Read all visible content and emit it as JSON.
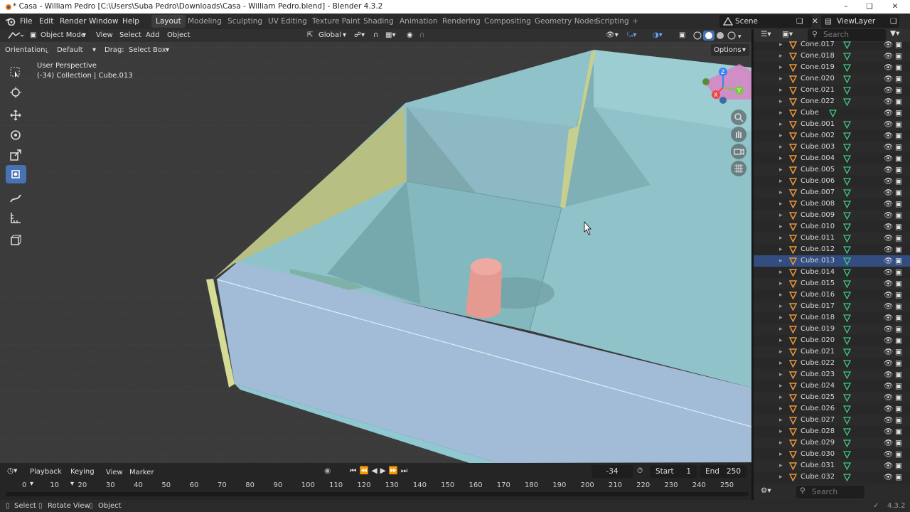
{
  "window": {
    "title": "* Casa - William Pedro [C:\\Users\\Suba Pedro\\Downloads\\Casa - William Pedro.blend] - Blender 4.3.2"
  },
  "menu": {
    "items": [
      "File",
      "Edit",
      "Render",
      "Window",
      "Help"
    ]
  },
  "workspaces": [
    {
      "label": "Layout",
      "active": true
    },
    {
      "label": "Modeling",
      "active": false
    },
    {
      "label": "Sculpting",
      "active": false
    },
    {
      "label": "UV Editing",
      "active": false
    },
    {
      "label": "Texture Paint",
      "active": false
    },
    {
      "label": "Shading",
      "active": false
    },
    {
      "label": "Animation",
      "active": false
    },
    {
      "label": "Rendering",
      "active": false
    },
    {
      "label": "Compositing",
      "active": false
    },
    {
      "label": "Geometry Nodes",
      "active": false
    },
    {
      "label": "Scripting",
      "active": false
    }
  ],
  "add_workspace": "+",
  "scene": {
    "name": "Scene",
    "view_layer": "ViewLayer"
  },
  "viewport_header": {
    "mode": "Object Mode",
    "menus": [
      "View",
      "Select",
      "Add",
      "Object"
    ],
    "transform_orientation": "Global",
    "orientation_label": "Orientation:",
    "orientation_value": "Default",
    "drag_label": "Drag:",
    "drag_value": "Select Box",
    "options": "Options"
  },
  "viewport_overlay": {
    "perspective": "User Perspective",
    "collection": "(-34) Collection | Cube.013"
  },
  "outliner": {
    "search_placeholder": "Search",
    "items": [
      {
        "label": "Cone.017",
        "selected": false
      },
      {
        "label": "Cone.018",
        "selected": false
      },
      {
        "label": "Cone.019",
        "selected": false
      },
      {
        "label": "Cone.020",
        "selected": false
      },
      {
        "label": "Cone.021",
        "selected": false
      },
      {
        "label": "Cone.022",
        "selected": false
      },
      {
        "label": "Cube",
        "selected": false
      },
      {
        "label": "Cube.001",
        "selected": false
      },
      {
        "label": "Cube.002",
        "selected": false
      },
      {
        "label": "Cube.003",
        "selected": false
      },
      {
        "label": "Cube.004",
        "selected": false
      },
      {
        "label": "Cube.005",
        "selected": false
      },
      {
        "label": "Cube.006",
        "selected": false
      },
      {
        "label": "Cube.007",
        "selected": false
      },
      {
        "label": "Cube.008",
        "selected": false
      },
      {
        "label": "Cube.009",
        "selected": false
      },
      {
        "label": "Cube.010",
        "selected": false
      },
      {
        "label": "Cube.011",
        "selected": false
      },
      {
        "label": "Cube.012",
        "selected": false
      },
      {
        "label": "Cube.013",
        "selected": true
      },
      {
        "label": "Cube.014",
        "selected": false
      },
      {
        "label": "Cube.015",
        "selected": false
      },
      {
        "label": "Cube.016",
        "selected": false
      },
      {
        "label": "Cube.017",
        "selected": false
      },
      {
        "label": "Cube.018",
        "selected": false
      },
      {
        "label": "Cube.019",
        "selected": false
      },
      {
        "label": "Cube.020",
        "selected": false
      },
      {
        "label": "Cube.021",
        "selected": false
      },
      {
        "label": "Cube.022",
        "selected": false
      },
      {
        "label": "Cube.023",
        "selected": false
      },
      {
        "label": "Cube.024",
        "selected": false
      },
      {
        "label": "Cube.025",
        "selected": false
      },
      {
        "label": "Cube.026",
        "selected": false
      },
      {
        "label": "Cube.027",
        "selected": false
      },
      {
        "label": "Cube.028",
        "selected": false
      },
      {
        "label": "Cube.029",
        "selected": false
      },
      {
        "label": "Cube.030",
        "selected": false
      },
      {
        "label": "Cube.031",
        "selected": false
      },
      {
        "label": "Cube.032",
        "selected": false
      }
    ]
  },
  "properties_search_placeholder": "Search",
  "timeline": {
    "menus": [
      "Playback",
      "Keying",
      "View",
      "Marker"
    ],
    "current_frame": "-34",
    "start_label": "Start",
    "start": "1",
    "end_label": "End",
    "end": "250",
    "ticks": [
      "0",
      "10",
      "20",
      "30",
      "40",
      "50",
      "60",
      "70",
      "80",
      "90",
      "100",
      "110",
      "120",
      "130",
      "140",
      "150",
      "160",
      "170",
      "180",
      "190",
      "200",
      "210",
      "220",
      "230",
      "240",
      "250"
    ]
  },
  "statusbar": {
    "items": [
      "Select",
      "Rotate View",
      "Object"
    ],
    "version": "4.3.2"
  },
  "colors": {
    "accent": "#4772b3",
    "selected_row": "#334d80",
    "mesh_orange": "#e8963c",
    "data_green": "#3fc77f"
  }
}
